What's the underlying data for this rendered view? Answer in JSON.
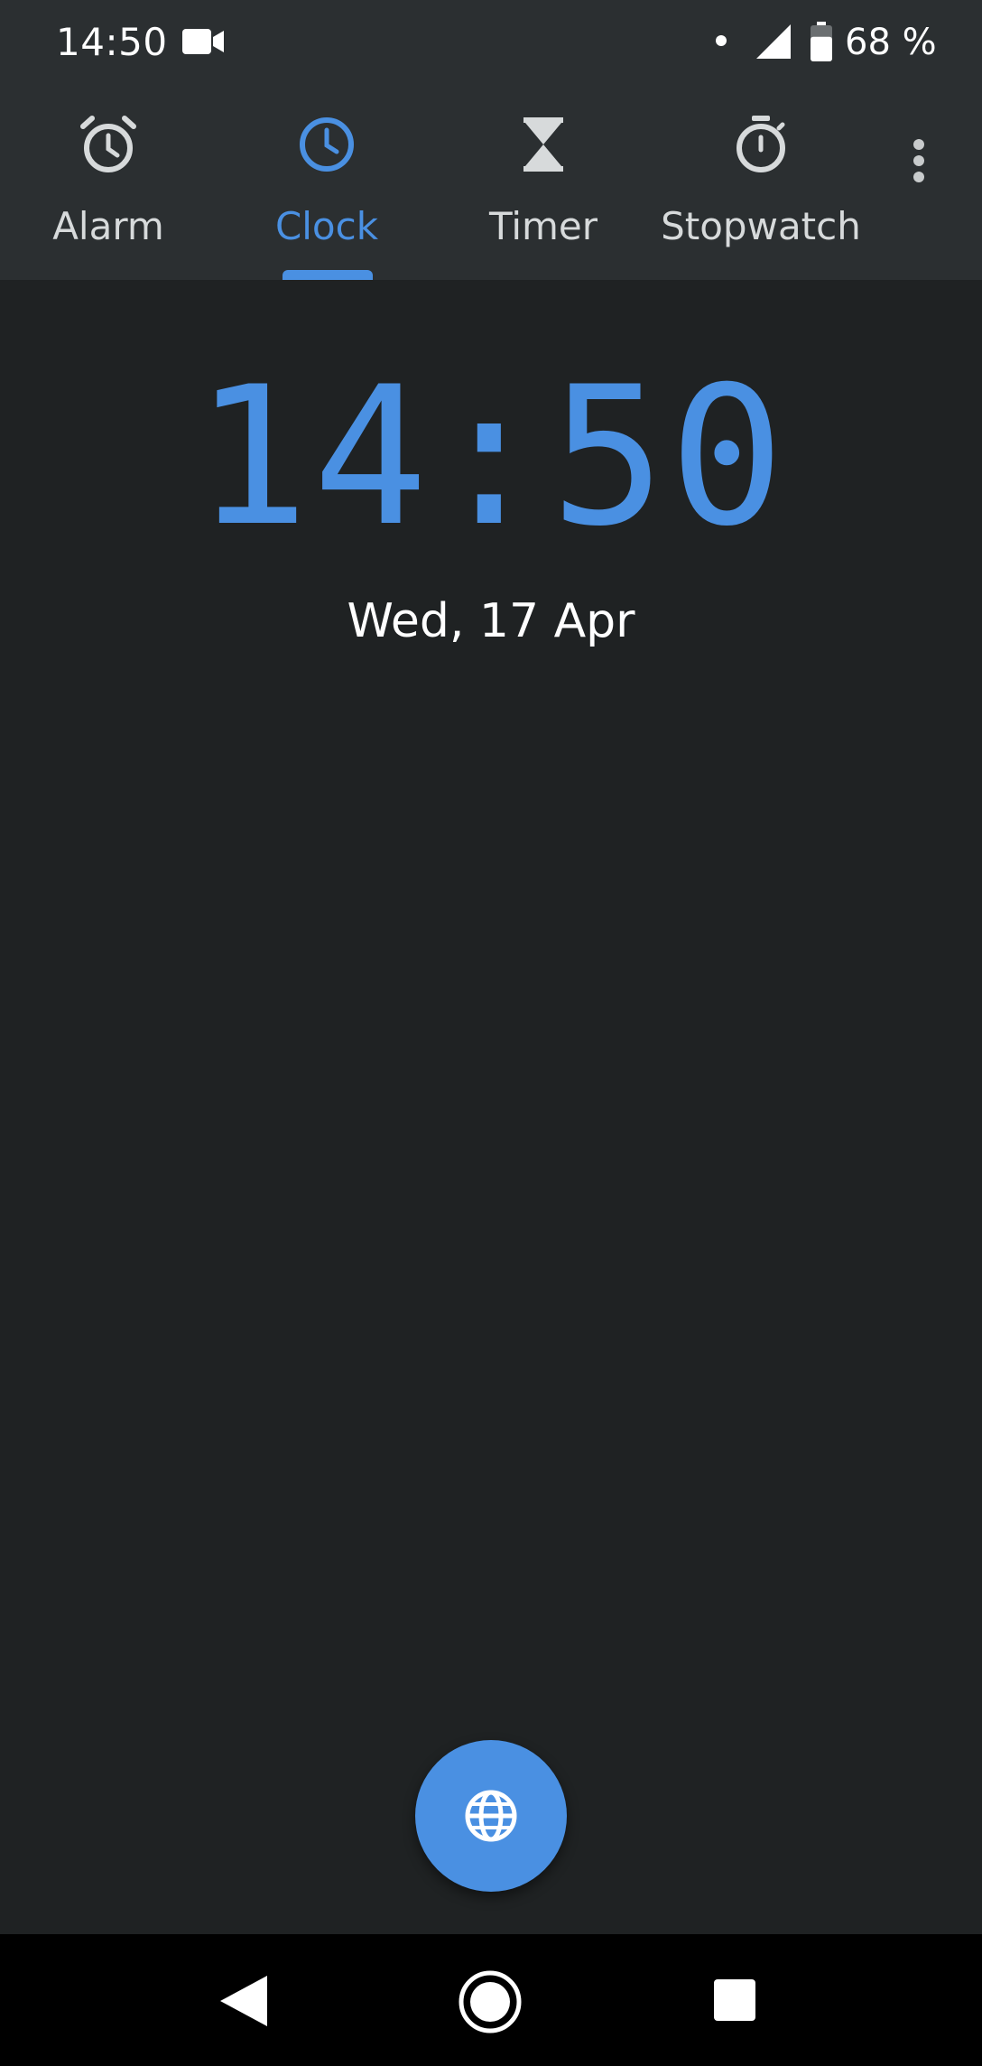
{
  "status_bar": {
    "time": "14:50",
    "battery_text": "68 %",
    "battery_level": 0.68,
    "icons": [
      "video-camera-icon",
      "notification-dot-icon",
      "cellular-signal-icon",
      "battery-icon"
    ]
  },
  "tabs": [
    {
      "label": "Alarm",
      "icon": "alarm-clock-icon",
      "active": false
    },
    {
      "label": "Clock",
      "icon": "clock-icon",
      "active": true
    },
    {
      "label": "Timer",
      "icon": "hourglass-icon",
      "active": false
    },
    {
      "label": "Stopwatch",
      "icon": "stopwatch-icon",
      "active": false
    }
  ],
  "overflow_menu": {
    "icon": "more-vertical-icon"
  },
  "main": {
    "time": "14:50",
    "date": "Wed, 17 Apr"
  },
  "fab": {
    "icon": "globe-icon"
  },
  "nav_bar": {
    "icons": [
      "back-triangle-icon",
      "home-circle-icon",
      "recents-square-icon"
    ]
  },
  "colors": {
    "accent": "#4a90e2",
    "header_bg": "#2b2f31",
    "content_bg": "#1f2223",
    "tab_text": "#d7dadb",
    "nav_bg": "#000000"
  }
}
